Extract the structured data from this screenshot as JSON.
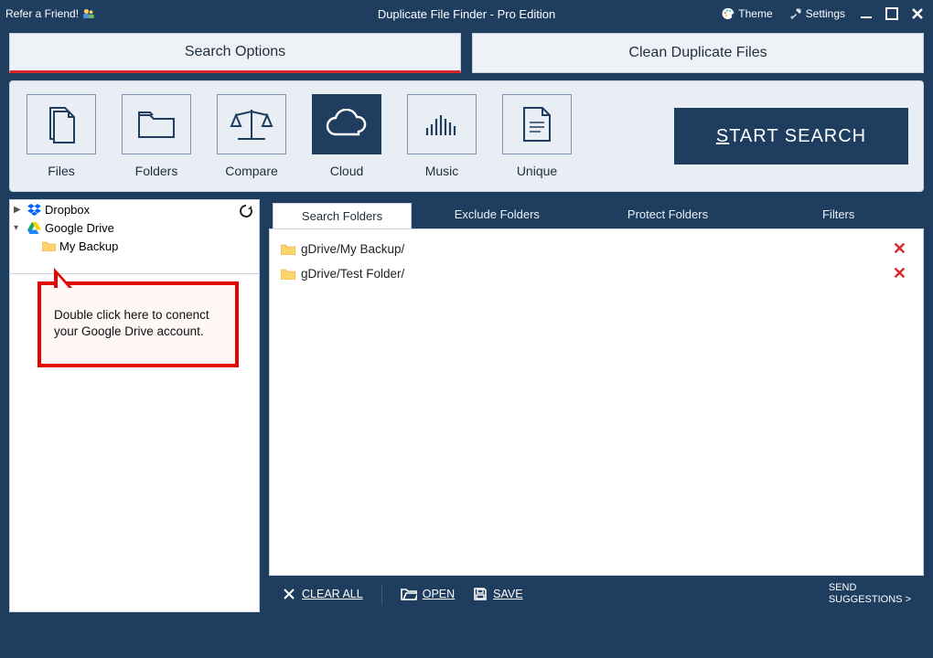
{
  "titlebar": {
    "refer": "Refer a Friend!",
    "title": "Duplicate File Finder - Pro Edition",
    "theme": "Theme",
    "settings": "Settings"
  },
  "top_tabs": {
    "search_options": "Search Options",
    "clean_duplicates": "Clean Duplicate Files"
  },
  "toolbar": {
    "items": [
      {
        "label": "Files"
      },
      {
        "label": "Folders"
      },
      {
        "label": "Compare"
      },
      {
        "label": "Cloud"
      },
      {
        "label": "Music"
      },
      {
        "label": "Unique"
      }
    ],
    "start_label": "TART SEARCH",
    "start_prefix": "S"
  },
  "tree": {
    "dropbox": "Dropbox",
    "google_drive": "Google Drive",
    "my_backup": "My Backup"
  },
  "callout": {
    "text": "Double click here to conenct your Google Drive account."
  },
  "sub_tabs": {
    "search_folders": "Search Folders",
    "exclude_folders": "Exclude Folders",
    "protect_folders": "Protect Folders",
    "filters": "Filters"
  },
  "folders": [
    {
      "path": "gDrive/My Backup/"
    },
    {
      "path": "gDrive/Test Folder/"
    }
  ],
  "bottom": {
    "clear_all": "CLEAR ALL",
    "open": "OPEN",
    "save": "SAVE",
    "send_line1": "SEND",
    "send_line2": "SUGGESTIONS >"
  },
  "colors": {
    "brand": "#1f3e5f",
    "accent_red": "#d8262b",
    "panel": "#e9eef4"
  }
}
